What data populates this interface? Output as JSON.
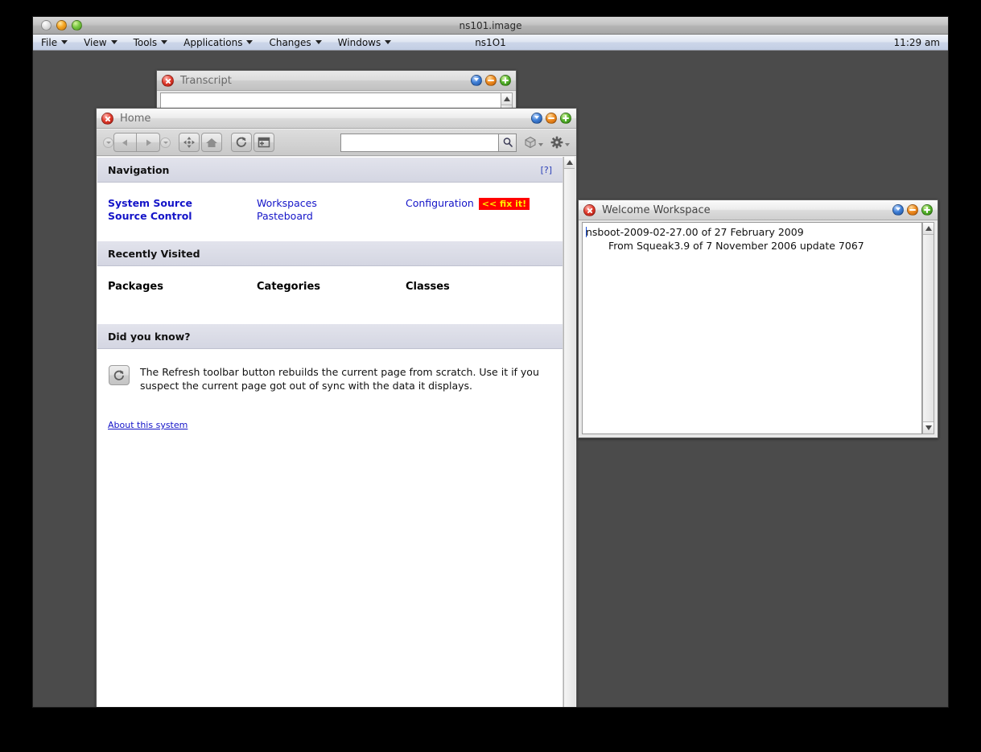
{
  "host": {
    "title": "ns101.image",
    "menus": [
      {
        "label": "File"
      },
      {
        "label": "View"
      },
      {
        "label": "Tools"
      },
      {
        "label": "Applications"
      },
      {
        "label": "Changes"
      },
      {
        "label": "Windows"
      }
    ],
    "center_label": "ns1O1",
    "clock": "11:29 am"
  },
  "transcript": {
    "title": "Transcript"
  },
  "home": {
    "title": "Home",
    "toolbar": {
      "back_icon": "back-arrow-icon",
      "forward_icon": "forward-arrow-icon",
      "navigate_icon": "four-way-navigate-icon",
      "home_icon": "home-icon",
      "refresh_icon": "refresh-icon",
      "new_window_icon": "new-window-icon",
      "search_icon": "magnifier-icon",
      "bookmarks_icon": "polyhedron-icon",
      "settings_icon": "gear-icon",
      "search_value": "",
      "search_placeholder": ""
    },
    "sections": [
      {
        "id": "navigation",
        "title": "Navigation",
        "help": "[?]",
        "col_a": [
          {
            "label": "System Source",
            "bold": true
          },
          {
            "label": "Source Control",
            "bold": true
          }
        ],
        "col_b": [
          {
            "label": "Workspaces",
            "bold": false
          },
          {
            "label": "Pasteboard",
            "bold": false
          }
        ],
        "col_c": [
          {
            "label": "Configuration",
            "bold": false,
            "badge": "<< fix it!"
          }
        ]
      },
      {
        "id": "recently-visited",
        "title": "Recently Visited",
        "headings": [
          "Packages",
          "Categories",
          "Classes"
        ]
      },
      {
        "id": "did-you-know",
        "title": "Did you know?",
        "tip_icon": "refresh-icon",
        "tip": "The Refresh toolbar button rebuilds the current page from scratch. Use it if you suspect the current page got out of sync with the data it displays.",
        "about_link": "About this system"
      }
    ]
  },
  "welcome": {
    "title": "Welcome Workspace",
    "line1": "nsboot-2009-02-27.00 of 27 February 2009",
    "line2": "From Squeak3.9 of 7 November 2006 update 7067"
  },
  "colors": {
    "desktop": "#4b4b4b",
    "section_header": "#d6d8e4",
    "link": "#1414c8",
    "badge_bg": "#ff0000",
    "badge_fg": "#ffee00"
  }
}
